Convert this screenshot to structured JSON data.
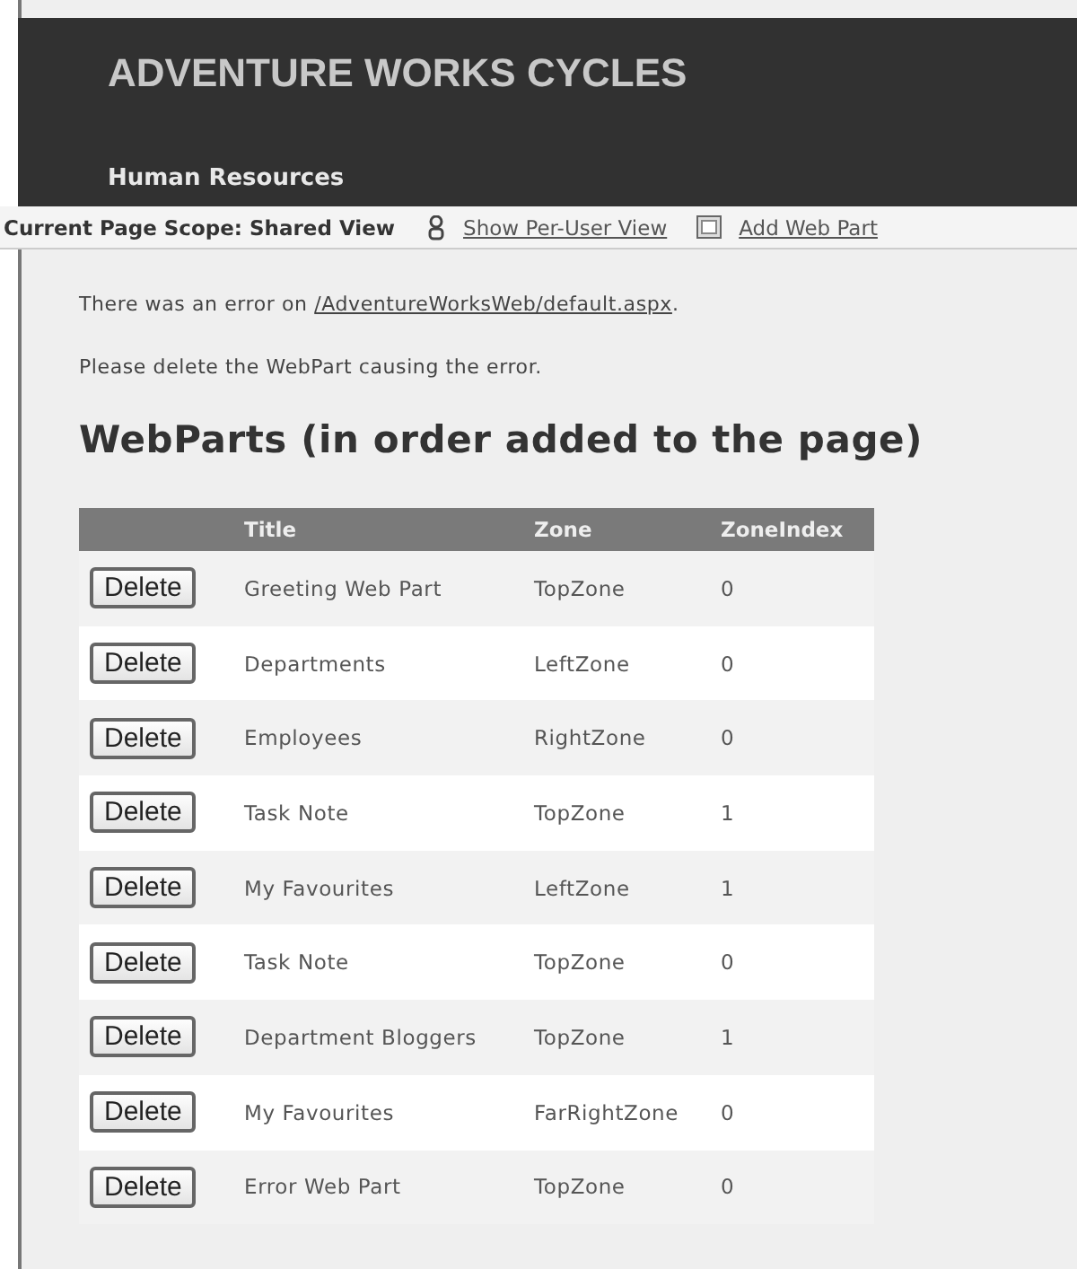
{
  "header": {
    "title": "ADVENTURE WORKS CYCLES",
    "subtitle": "Human Resources"
  },
  "toolbar": {
    "scope": "Current Page Scope: Shared View",
    "links": [
      {
        "label": "Show Per-User View",
        "kind": "user"
      },
      {
        "label": "Add Web Part",
        "kind": "add"
      }
    ]
  },
  "message": {
    "prefix": "There was an error on ",
    "link": "/AdventureWorksWeb/default.aspx",
    "suffix": ".",
    "instruction": "Please delete the WebPart causing the error."
  },
  "heading": "WebParts (in order added to the page)",
  "table": {
    "columns": [
      "Title",
      "Zone",
      "ZoneIndex"
    ],
    "rows": [
      {
        "action": "Delete",
        "title": "Greeting Web Part",
        "zone": "TopZone",
        "index": "0"
      },
      {
        "action": "Delete",
        "title": "Departments",
        "zone": "LeftZone",
        "index": "0"
      },
      {
        "action": "Delete",
        "title": "Employees",
        "zone": "RightZone",
        "index": "0"
      },
      {
        "action": "Delete",
        "title": "Task Note",
        "zone": "TopZone",
        "index": "1"
      },
      {
        "action": "Delete",
        "title": "My Favourites",
        "zone": "LeftZone",
        "index": "1"
      },
      {
        "action": "Delete",
        "title": "Task Note",
        "zone": "TopZone",
        "index": "0"
      },
      {
        "action": "Delete",
        "title": "Department Bloggers",
        "zone": "TopZone",
        "index": "1"
      },
      {
        "action": "Delete",
        "title": "My Favourites",
        "zone": "FarRightZone",
        "index": "0"
      },
      {
        "action": "Delete",
        "title": "Error Web Part",
        "zone": "TopZone",
        "index": "0"
      }
    ]
  }
}
